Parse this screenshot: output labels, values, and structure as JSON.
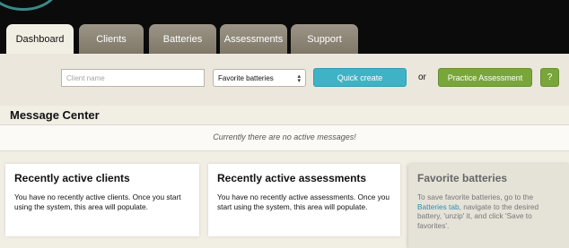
{
  "nav": {
    "tabs": [
      {
        "label": "Dashboard",
        "active": true
      },
      {
        "label": "Clients",
        "active": false
      },
      {
        "label": "Batteries",
        "active": false
      },
      {
        "label": "Assessments",
        "active": false
      },
      {
        "label": "Support",
        "active": false
      }
    ]
  },
  "toolbar": {
    "client_placeholder": "Client name",
    "client_value": "",
    "favorite_select": "Favorite batteries",
    "quick_create": "Quick create",
    "or_text": "or",
    "practice": "Practice Assessment",
    "help": "?"
  },
  "message_center": {
    "title": "Message Center",
    "message": "Currently there are no active messages!"
  },
  "cards": {
    "clients": {
      "title": "Recently active clients",
      "text": "You have no recently active clients. Once you start using the system, this area will populate."
    },
    "assessments": {
      "title": "Recently active assessments",
      "text": "You have no recently active assessments. Once you start using the system, this area will populate."
    },
    "favorites": {
      "title": "Favorite batteries",
      "text_before": "To save favorite batteries, go to the ",
      "link": "Batteries tab",
      "text_after": ", navigate to the desired battery, 'unzip' it, and click 'Save to favorites'."
    }
  },
  "colors": {
    "accent_blue": "#3fb3c6",
    "accent_green": "#79a63a",
    "link": "#2a8fb2",
    "background": "#f1eee4"
  }
}
